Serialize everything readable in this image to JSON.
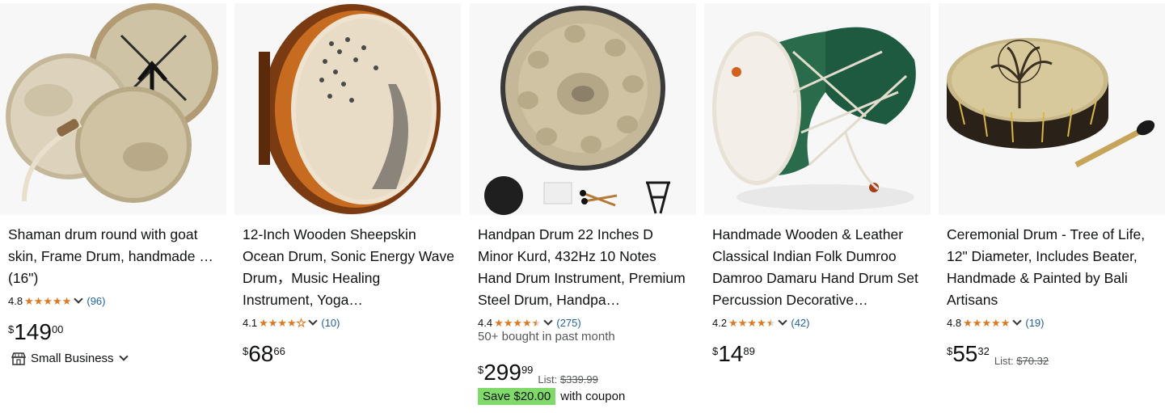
{
  "products": [
    {
      "title": "Shaman drum round with goat skin, Frame Drum, handmade … (16\")",
      "rating": "4.8",
      "count": "(96)",
      "price_symbol": "$",
      "price_whole": "149",
      "price_fraction": "00",
      "small_business_label": "Small Business",
      "image_icon": "shaman-drums-image"
    },
    {
      "title": "12-Inch Wooden Sheepskin Ocean Drum, Sonic Energy Wave Drum，Music Healing Instrument, Yoga…",
      "rating": "4.1",
      "count": "(10)",
      "price_symbol": "$",
      "price_whole": "68",
      "price_fraction": "66",
      "image_icon": "ocean-drum-image"
    },
    {
      "title": "Handpan Drum 22 Inches D Minor Kurd, 432Hz 10 Notes Hand Drum Instrument, Premium Steel Drum, Handpa…",
      "rating": "4.4",
      "count": "(275)",
      "bought": "50+ bought in past month",
      "price_symbol": "$",
      "price_whole": "299",
      "price_fraction": "99",
      "list_label": "List:",
      "list_price": "$339.99",
      "coupon_badge": "Save $20.00",
      "coupon_text": "with coupon",
      "image_icon": "handpan-drum-image"
    },
    {
      "title": "Handmade Wooden & Leather Classical Indian Folk Dumroo Damroo Damaru Hand Drum Set Percussion Decorative…",
      "rating": "4.2",
      "count": "(42)",
      "price_symbol": "$",
      "price_whole": "14",
      "price_fraction": "89",
      "image_icon": "damaru-drum-image"
    },
    {
      "title": "Ceremonial Drum - Tree of Life, 12\" Diameter, Includes Beater, Handmade & Painted by Bali Artisans",
      "rating": "4.8",
      "count": "(19)",
      "price_symbol": "$",
      "price_whole": "55",
      "price_fraction": "32",
      "list_label": "List:",
      "list_price": "$70.32",
      "image_icon": "ceremonial-drum-image"
    }
  ],
  "colors": {
    "star": "#de7921",
    "link": "#2162a1",
    "coupon": "#7fda69",
    "muted": "#565959",
    "image_bg": "#f7f7f7"
  }
}
